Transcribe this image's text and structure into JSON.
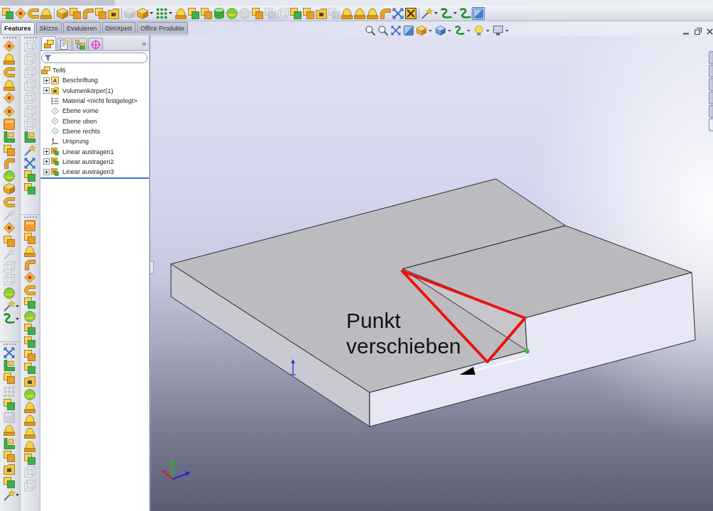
{
  "main_toolbar": [
    {
      "kind": "button",
      "disabled": false,
      "on": false
    },
    {
      "kind": "button",
      "disabled": false,
      "on": false
    },
    {
      "kind": "button",
      "disabled": false,
      "on": false
    },
    {
      "kind": "button",
      "disabled": false,
      "on": false
    },
    {
      "kind": "button",
      "disabled": false,
      "on": false
    },
    {
      "kind": "button",
      "disabled": false,
      "on": false
    },
    {
      "kind": "button",
      "disabled": false,
      "on": false
    },
    {
      "kind": "button",
      "disabled": false,
      "on": false
    },
    {
      "kind": "button",
      "disabled": false,
      "on": false
    },
    {
      "kind": "button",
      "disabled": true,
      "on": false
    },
    {
      "kind": "dropdown",
      "disabled": false,
      "on": false
    },
    {
      "kind": "dropdown",
      "disabled": false,
      "on": false
    },
    {
      "kind": "button",
      "disabled": false,
      "on": false
    },
    {
      "kind": "button",
      "disabled": false,
      "on": false
    },
    {
      "kind": "button",
      "disabled": false,
      "on": false
    },
    {
      "kind": "button",
      "disabled": false,
      "on": false
    },
    {
      "kind": "button",
      "disabled": false,
      "on": false
    },
    {
      "kind": "button",
      "disabled": true,
      "on": false
    },
    {
      "kind": "button",
      "disabled": false,
      "on": false
    },
    {
      "kind": "button",
      "disabled": true,
      "on": false
    },
    {
      "kind": "button",
      "disabled": true,
      "on": false
    },
    {
      "kind": "button",
      "disabled": false,
      "on": false
    },
    {
      "kind": "button",
      "disabled": false,
      "on": false
    },
    {
      "kind": "button",
      "disabled": false,
      "on": false
    },
    {
      "kind": "button",
      "disabled": true,
      "on": false
    },
    {
      "kind": "button",
      "disabled": false,
      "on": false
    },
    {
      "kind": "button",
      "disabled": false,
      "on": false
    },
    {
      "kind": "button",
      "disabled": false,
      "on": false
    },
    {
      "kind": "button",
      "disabled": false,
      "on": false
    },
    {
      "kind": "button",
      "disabled": false,
      "on": false
    },
    {
      "kind": "button",
      "disabled": false,
      "on": false
    },
    {
      "kind": "dropdown",
      "disabled": false,
      "on": false
    },
    {
      "kind": "dropdown",
      "disabled": false,
      "on": false
    },
    {
      "kind": "button",
      "disabled": false,
      "on": false
    },
    {
      "kind": "button",
      "disabled": false,
      "on": true
    }
  ],
  "command_tabs": [
    {
      "label": "Features",
      "selected": true
    },
    {
      "label": "Skizze",
      "selected": false
    },
    {
      "label": "Evaluieren",
      "selected": false
    },
    {
      "label": "DimXpert",
      "selected": false
    },
    {
      "label": "Office Produkte",
      "selected": false
    }
  ],
  "left_toolbars": [
    {
      "groups": [
        [
          {
            "kind": "button",
            "disabled": false
          },
          {
            "kind": "button",
            "disabled": false
          },
          {
            "kind": "button",
            "disabled": false
          },
          {
            "kind": "button",
            "disabled": false
          },
          {
            "kind": "button",
            "disabled": false
          },
          {
            "kind": "button",
            "disabled": false
          },
          {
            "kind": "button",
            "disabled": false
          },
          {
            "kind": "button",
            "disabled": false
          },
          {
            "kind": "button",
            "disabled": false
          },
          {
            "kind": "button",
            "disabled": false
          },
          {
            "kind": "button",
            "disabled": false
          },
          {
            "kind": "button",
            "disabled": false
          },
          {
            "kind": "button",
            "disabled": false
          },
          {
            "kind": "button",
            "disabled": true
          },
          {
            "kind": "button",
            "disabled": false
          },
          {
            "kind": "button",
            "disabled": false
          },
          {
            "kind": "button",
            "disabled": true
          },
          {
            "kind": "button",
            "disabled": true
          },
          {
            "kind": "button",
            "disabled": true
          },
          {
            "kind": "button",
            "disabled": false
          },
          {
            "kind": "dropdown",
            "disabled": false
          },
          {
            "kind": "dropdown",
            "disabled": false
          }
        ],
        [
          {
            "kind": "button",
            "disabled": false
          },
          {
            "kind": "button",
            "disabled": false
          },
          {
            "kind": "button",
            "disabled": false
          },
          {
            "kind": "button",
            "disabled": true
          },
          {
            "kind": "button",
            "disabled": false
          },
          {
            "kind": "button",
            "disabled": true
          },
          {
            "kind": "button",
            "disabled": false
          },
          {
            "kind": "button",
            "disabled": false
          },
          {
            "kind": "button",
            "disabled": false
          },
          {
            "kind": "button",
            "disabled": false
          },
          {
            "kind": "button",
            "disabled": false
          },
          {
            "kind": "dropdown",
            "disabled": false
          }
        ]
      ]
    },
    {
      "groups": [
        [
          {
            "kind": "button",
            "disabled": true
          },
          {
            "kind": "button",
            "disabled": true
          },
          {
            "kind": "button",
            "disabled": true
          },
          {
            "kind": "button",
            "disabled": true
          },
          {
            "kind": "button",
            "disabled": true
          },
          {
            "kind": "button",
            "disabled": true
          },
          {
            "kind": "button",
            "disabled": true
          },
          {
            "kind": "button",
            "disabled": false
          },
          {
            "kind": "button",
            "disabled": false
          },
          {
            "kind": "button",
            "disabled": false
          },
          {
            "kind": "button",
            "disabled": false
          },
          {
            "kind": "button",
            "disabled": false
          }
        ],
        [
          {
            "kind": "button",
            "disabled": false
          },
          {
            "kind": "button",
            "disabled": false
          },
          {
            "kind": "button",
            "disabled": false
          },
          {
            "kind": "button",
            "disabled": false
          },
          {
            "kind": "button",
            "disabled": false
          },
          {
            "kind": "button",
            "disabled": false
          },
          {
            "kind": "button",
            "disabled": false
          },
          {
            "kind": "button",
            "disabled": false
          },
          {
            "kind": "button",
            "disabled": false
          },
          {
            "kind": "button",
            "disabled": false
          },
          {
            "kind": "button",
            "disabled": false
          },
          {
            "kind": "button",
            "disabled": false
          },
          {
            "kind": "button",
            "disabled": false
          },
          {
            "kind": "button",
            "disabled": false
          },
          {
            "kind": "button",
            "disabled": false
          },
          {
            "kind": "button",
            "disabled": false
          },
          {
            "kind": "button",
            "disabled": false
          },
          {
            "kind": "button",
            "disabled": false
          },
          {
            "kind": "button",
            "disabled": false
          },
          {
            "kind": "button",
            "disabled": true
          },
          {
            "kind": "button",
            "disabled": true
          }
        ]
      ]
    }
  ],
  "feature_manager": {
    "tabs": [
      {
        "kind": "features",
        "selected": true
      },
      {
        "kind": "properties",
        "selected": false
      },
      {
        "kind": "configurations",
        "selected": false
      },
      {
        "kind": "dimxpert",
        "selected": false
      }
    ],
    "overflow_button": "»",
    "tree": {
      "label": "Teil6",
      "children": [
        {
          "kind": "annotations",
          "label": "Beschriftung",
          "icon_text": "A",
          "expanded": false
        },
        {
          "kind": "bodies",
          "label": "Volumenkörper(1)",
          "expanded": false
        },
        {
          "kind": "material",
          "label": "Material <nicht festgelegt>"
        },
        {
          "kind": "plane",
          "label": "Ebene vorne"
        },
        {
          "kind": "plane",
          "label": "Ebene oben"
        },
        {
          "kind": "plane",
          "label": "Ebene rechts"
        },
        {
          "kind": "origin",
          "label": "Ursprung"
        },
        {
          "kind": "extrusion",
          "label": "Linear austragen1",
          "expanded": false
        },
        {
          "kind": "extrusion",
          "label": "Linear austragen2",
          "expanded": false
        },
        {
          "kind": "extrusion",
          "label": "Linear austragen3",
          "expanded": false
        }
      ]
    }
  },
  "graphics_area": {
    "annotation": "Punkt verschieben"
  }
}
